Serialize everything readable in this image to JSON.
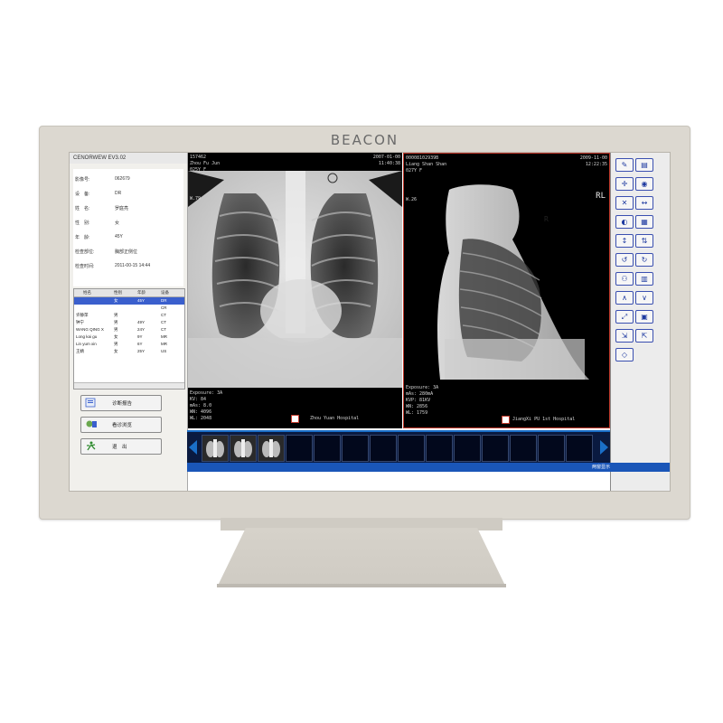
{
  "brand": "BEACON",
  "app": {
    "title": "CENORWEW ЕV3.02"
  },
  "patient": {
    "rows": [
      {
        "label": "影像号:",
        "value": "062679"
      },
      {
        "label": "设　备:",
        "value": "DR"
      },
      {
        "label": "姓　名:",
        "value": "罗庭亮"
      },
      {
        "label": "性　别:",
        "value": "女"
      },
      {
        "label": "年　龄:",
        "value": "45Y"
      },
      {
        "label": "检查部位:",
        "value": "胸部正侧位"
      },
      {
        "label": "检查时间:",
        "value": "2011-00-15 14:44"
      }
    ]
  },
  "list": {
    "columns": [
      "姓名",
      "性别",
      "年龄",
      "设备"
    ],
    "rows": [
      [
        "",
        "女",
        "45Y",
        "DR"
      ],
      [
        "",
        "",
        "",
        "CR"
      ],
      [
        "许静萍",
        "男",
        "",
        "CT"
      ],
      [
        "钟宁",
        "男",
        "49Y",
        "CT"
      ],
      [
        "WANG QING X",
        "男",
        "24Y",
        "CT"
      ],
      [
        "Long kai gu",
        "女",
        "9Y",
        "MR"
      ],
      [
        "Lin yum xin",
        "男",
        "6Y",
        "MR"
      ],
      [
        "王婧",
        "女",
        "25Y",
        "US"
      ]
    ]
  },
  "buttons": {
    "print_report": "诊断报告",
    "view_report": "看诊浏览",
    "exit": "退　出"
  },
  "viewer1": {
    "id": "157462",
    "name": "Zhou Fu Jun",
    "sex_age": "025Y F",
    "date": "2007-01-00",
    "time": "11:40:38",
    "wl": "W.79",
    "exposure": "Exposure: 3A",
    "kv": "KV: 84",
    "mas": "mAs: 8.0",
    "wn": "WN: 4096",
    "wl_bottom": "WL: 2048",
    "hospital": "Zhou Yuan Hospital"
  },
  "viewer2": {
    "id": "00008102939B",
    "name": "Liang Shan Shan",
    "sex_age": "027Y F",
    "date": "2009-11-00",
    "time": "12:22:35",
    "wl": "W.26",
    "orientation": "RL",
    "marker": "R",
    "exposure": "Exposure: 3A",
    "mas": "mAs: 280mA",
    "kvp": "KVP: 81KV",
    "wn": "WN: 2856",
    "wl_bottom": "WL: 1759",
    "hospital": "JiangXi PU 1st Hospital"
  },
  "status": {
    "label": "两窗显示"
  },
  "toolbar": {
    "icons": [
      "report-icon",
      "save-icon",
      "crosshair-icon",
      "target-icon",
      "magnify-icon",
      "measure-icon",
      "contrast-icon",
      "grid-icon",
      "flip-horizontal-icon",
      "flip-vertical-icon",
      "rotate-left-icon",
      "rotate-right-icon",
      "person-icon",
      "layout-icon",
      "arrow-up-icon",
      "arrow-down-icon",
      "annotation-icon",
      "print-icon",
      "import-icon",
      "export-icon",
      "eraser-icon"
    ],
    "glyphs": [
      "✎",
      "▤",
      "✛",
      "◉",
      "✕",
      "↔",
      "◐",
      "▦",
      "↕",
      "⇅",
      "↺",
      "↻",
      "⚇",
      "▥",
      "∧",
      "∨",
      "⤢",
      "▣",
      "⇲",
      "⇱",
      "◇"
    ]
  },
  "colors": {
    "accent": "#1a6fc8",
    "selection": "#3a5fcd",
    "frame": "#dcd8d0"
  }
}
